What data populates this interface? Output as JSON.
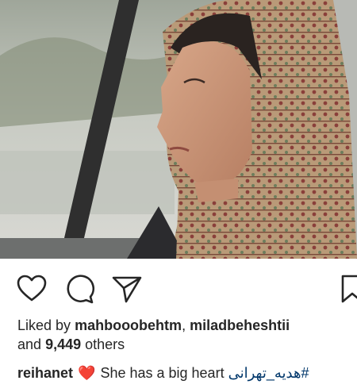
{
  "post": {
    "liked_by_prefix": "Liked by",
    "liked_user_1": "mahbooobehtm",
    "liked_separator": ",",
    "liked_user_2": "miladbeheshtii",
    "and_text": "and",
    "others_count": "9,449",
    "others_text": "others",
    "caption_user": "reihanet",
    "caption_emoji": "❤️",
    "caption_text": "She has a big heart",
    "caption_hashtag": "#هدیه_تهرانی"
  },
  "icons": {
    "like": "heart-outline-icon",
    "comment": "comment-bubble-icon",
    "share": "paper-plane-icon",
    "save": "bookmark-icon"
  },
  "colors": {
    "text": "#262626",
    "hashtag": "#00376b",
    "heart": "#e0245e"
  }
}
